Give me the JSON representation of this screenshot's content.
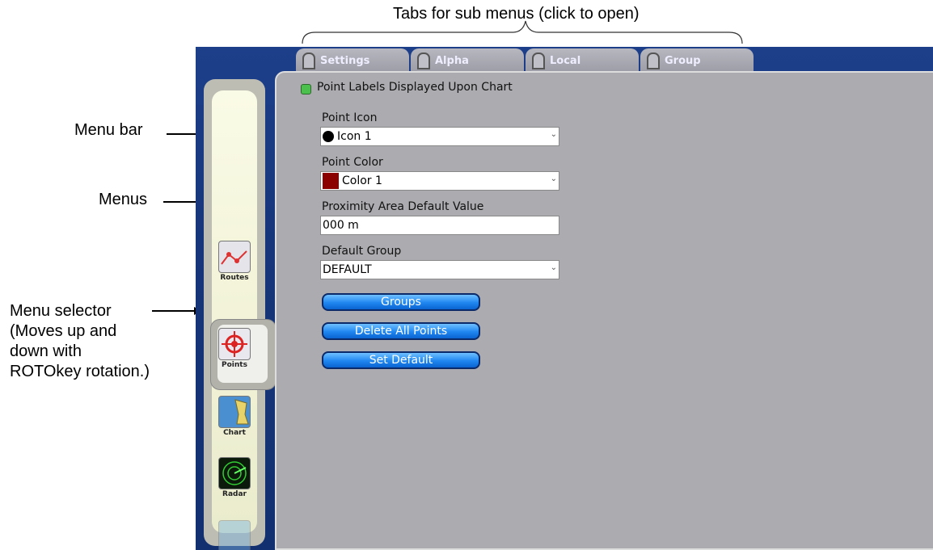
{
  "callouts": {
    "tabs_note": "Tabs for sub menus (click to open)",
    "menu_bar": "Menu bar",
    "menus": "Menus",
    "selector_line1": "Menu selector",
    "selector_line2": "(Moves up and",
    "selector_line3": "down with",
    "selector_line4": "ROTOkey rotation.)"
  },
  "tabs": [
    {
      "label": "Settings"
    },
    {
      "label": "Alpha"
    },
    {
      "label": "Local"
    },
    {
      "label": "Group"
    }
  ],
  "sidebar": {
    "items": [
      {
        "label": "Routes",
        "icon": "routes-icon"
      },
      {
        "label": "Points",
        "icon": "points-icon"
      },
      {
        "label": "Chart",
        "icon": "chart-icon"
      },
      {
        "label": "Radar",
        "icon": "radar-icon"
      },
      {
        "label": "",
        "icon": "next-menu-icon"
      }
    ]
  },
  "settings": {
    "labels_toggle": "Point Labels Displayed Upon Chart",
    "point_icon_label": "Point Icon",
    "point_icon_value": "Icon 1",
    "point_color_label": "Point Color",
    "point_color_value": "Color 1",
    "point_color_swatch": "#8b0000",
    "proximity_label": "Proximity Area Default Value",
    "proximity_value": "000 m",
    "default_group_label": "Default Group",
    "default_group_value": "DEFAULT"
  },
  "buttons": {
    "groups": "Groups",
    "delete_all": "Delete All Points",
    "set_default": "Set Default"
  },
  "colors": {
    "toggle_on": "#4cc04c",
    "button_blue": "#1f86f0"
  }
}
